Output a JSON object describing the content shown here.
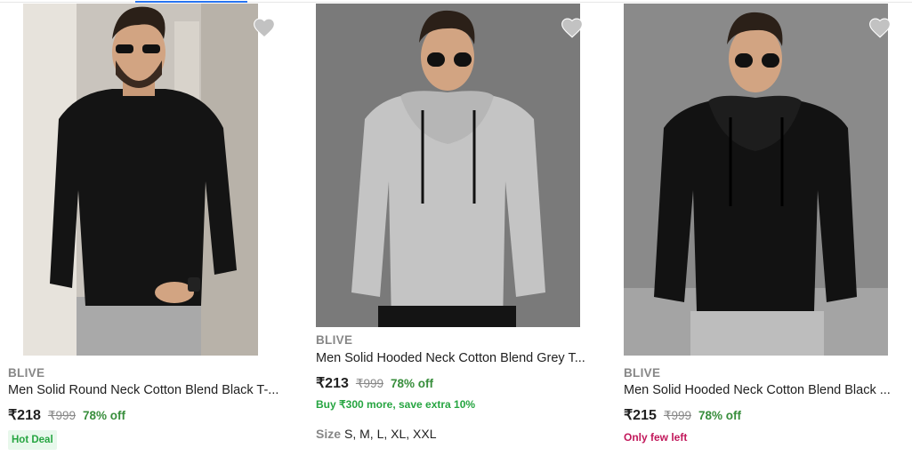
{
  "colors": {
    "accent": "#2874f0",
    "discount_green": "#388e3c",
    "offer_green": "#26a541",
    "few_left_pink": "#c2185b",
    "text_grey": "#878787"
  },
  "products": [
    {
      "image_alt": "man in black round neck t-shirt",
      "brand": "BLIVE",
      "title": "Men Solid Round Neck Cotton Blend Black T-...",
      "price": "₹218",
      "mrp": "₹999",
      "discount": "78% off",
      "badge": "Hot Deal",
      "wishlist_icon": "heart-icon"
    },
    {
      "image_alt": "man in grey hooded sweatshirt",
      "brand": "BLIVE",
      "title": "Men Solid Hooded Neck Cotton Blend Grey T...",
      "price": "₹213",
      "mrp": "₹999",
      "discount": "78% off",
      "offer": "Buy ₹300 more, save extra 10%",
      "size_label": "Size",
      "sizes": "S, M, L, XL, XXL",
      "wishlist_icon": "heart-icon"
    },
    {
      "image_alt": "man in black hooded sweatshirt",
      "brand": "BLIVE",
      "title": "Men Solid Hooded Neck Cotton Blend Black ...",
      "price": "₹215",
      "mrp": "₹999",
      "discount": "78% off",
      "stock": "Only few left",
      "wishlist_icon": "heart-icon"
    }
  ]
}
